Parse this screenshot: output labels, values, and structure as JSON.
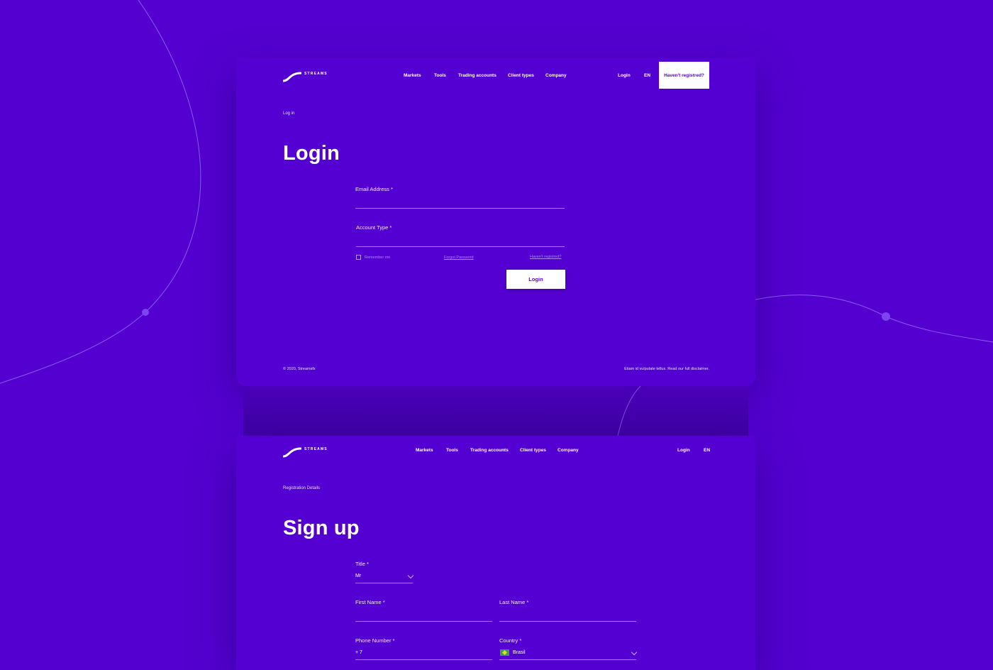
{
  "brand": {
    "logo_text": "STREAMS"
  },
  "nav": {
    "items": [
      "Markets",
      "Tools",
      "Trading accounts",
      "Client types",
      "Company"
    ],
    "login": "Login",
    "lang": "EN",
    "register_cta": "Haven't registred?"
  },
  "login_page": {
    "breadcrumb": "Log in",
    "title": "Login",
    "email_label": "Email Address *",
    "account_type_label": "Account Type *",
    "remember_me": "Remember me",
    "forgot_password": "Forgot Password",
    "havent_registred": "Haven't registred?",
    "login_button": "Login",
    "footer_left": "© 2020, Streamsfx",
    "footer_right": "Etiam id vulputate tellus. Read our full disclaimer."
  },
  "signup_page": {
    "breadcrumb": "Registration Details",
    "title": "Sign up",
    "title_label": "Title *",
    "title_value": "Mr",
    "first_name_label": "First Name *",
    "last_name_label": "Last Name *",
    "phone_label": "Phone Number *",
    "phone_value": "+ 7",
    "country_label": "Country *",
    "country_value": "Brasil"
  },
  "colors": {
    "background": "#5300d0",
    "button_bg": "#ffffff",
    "button_text": "#5300d0"
  }
}
